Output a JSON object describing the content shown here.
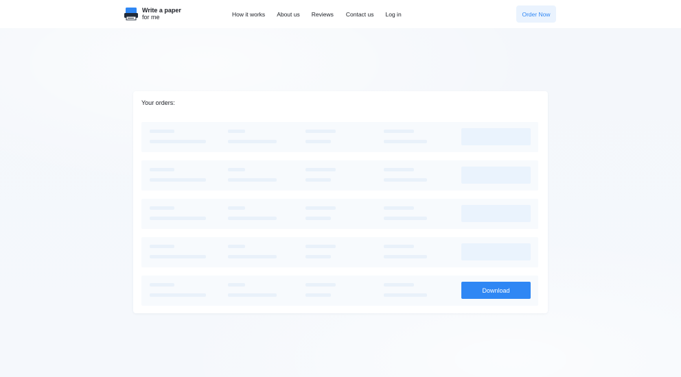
{
  "header": {
    "logo": {
      "line1": "Write a paper",
      "line2": "for me",
      "icon": "printer-logo-icon",
      "color": "#2f87f4"
    },
    "nav": [
      {
        "label": "How it works"
      },
      {
        "label": "About us"
      },
      {
        "label": "Reviews"
      },
      {
        "label": "Contact us"
      },
      {
        "label": "Log in"
      }
    ],
    "order_button": "Order Now"
  },
  "orders": {
    "title": "Your orders:",
    "rows_loading": 4,
    "download_label": "Download"
  },
  "colors": {
    "accent": "#2f87f4",
    "accent_light": "#eaf3fe",
    "skeleton": "#e9f1fa",
    "row_bg": "#f7fafd",
    "page_bg": "#f6f9fc"
  }
}
